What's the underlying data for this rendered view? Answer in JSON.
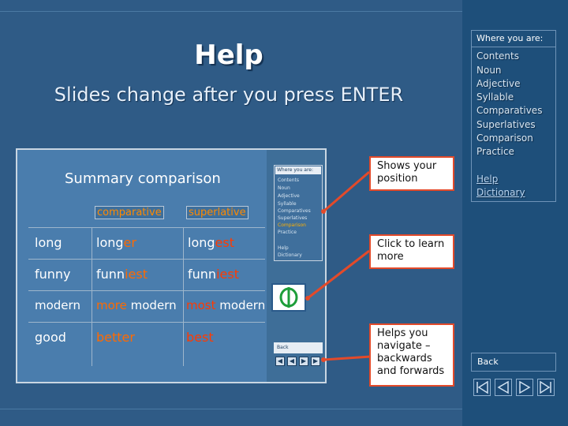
{
  "title": "Help",
  "subtitle": "Slides change after you press ENTER",
  "slide": {
    "title": "Summary comparison",
    "headers": [
      "comparative",
      "superlative"
    ],
    "rows": [
      {
        "base": "long",
        "comp_root": "long",
        "comp_suffix": "er",
        "sup_root": "long",
        "sup_suffix": "est"
      },
      {
        "base": "funny",
        "comp_root": "funn",
        "comp_suffix": "iest",
        "sup_root": "funn",
        "sup_suffix": "iest"
      },
      {
        "base": "modern",
        "comp_pre": "more",
        "comp_root": " modern",
        "sup_pre": "most",
        "sup_root": " modern"
      },
      {
        "base": "good",
        "comp_word": "better",
        "sup_word": "best"
      }
    ],
    "mini_sidebar": {
      "header": "Where you are:",
      "items": [
        "Contents",
        "Noun",
        "Adjective",
        "Syllable",
        "Comparatives",
        "Superlatives",
        "Comparison",
        "Practice",
        "",
        "Help",
        "Dictionary"
      ],
      "back": "Back"
    }
  },
  "callouts": {
    "position": "Shows your position",
    "learn": "Click to learn more",
    "navigate": "Helps you navigate – backwards and forwards"
  },
  "sidebar": {
    "header": "Where you are:",
    "items": [
      "Contents",
      "Noun",
      "Adjective",
      "Syllable",
      "Comparatives",
      "Superlatives",
      "Comparison",
      "Practice"
    ],
    "links": [
      "Help",
      "Dictionary"
    ],
    "back": "Back",
    "nav_icons": [
      "first-icon",
      "previous-icon",
      "next-icon",
      "last-icon"
    ]
  },
  "colors": {
    "background": "#2f5b86",
    "sidebar": "#1e4f7a",
    "callout_border": "#e34a2a",
    "highlight": "#ff6a00"
  }
}
